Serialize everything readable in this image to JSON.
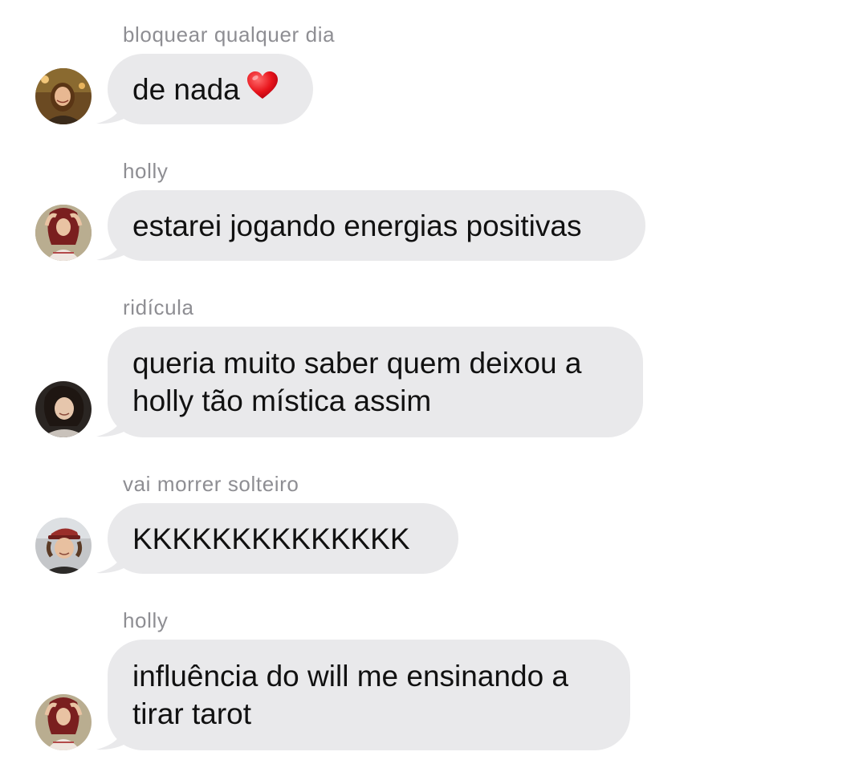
{
  "messages": [
    {
      "sender": "bloquear qualquer dia",
      "text": "de nada",
      "emoji": "heart-emoji",
      "avatar": "avatar-girl-smiling"
    },
    {
      "sender": "holly",
      "text": "estarei jogando energias positivas",
      "avatar": "avatar-holly"
    },
    {
      "sender": "ridícula",
      "lines": [
        "queria muito saber quem deixou a",
        "holly tão mística assim"
      ],
      "avatar": "avatar-dark-hair"
    },
    {
      "sender": "vai morrer solteiro",
      "text": "KKKKKKKKKKKKKK",
      "avatar": "avatar-guy-cap"
    },
    {
      "sender": "holly",
      "lines": [
        "influência do will me ensinando a",
        "tirar tarot"
      ],
      "avatar": "avatar-holly"
    }
  ],
  "colors": {
    "bubble": "#e9e9eb",
    "sender": "#8e8e93",
    "text": "#111111"
  }
}
